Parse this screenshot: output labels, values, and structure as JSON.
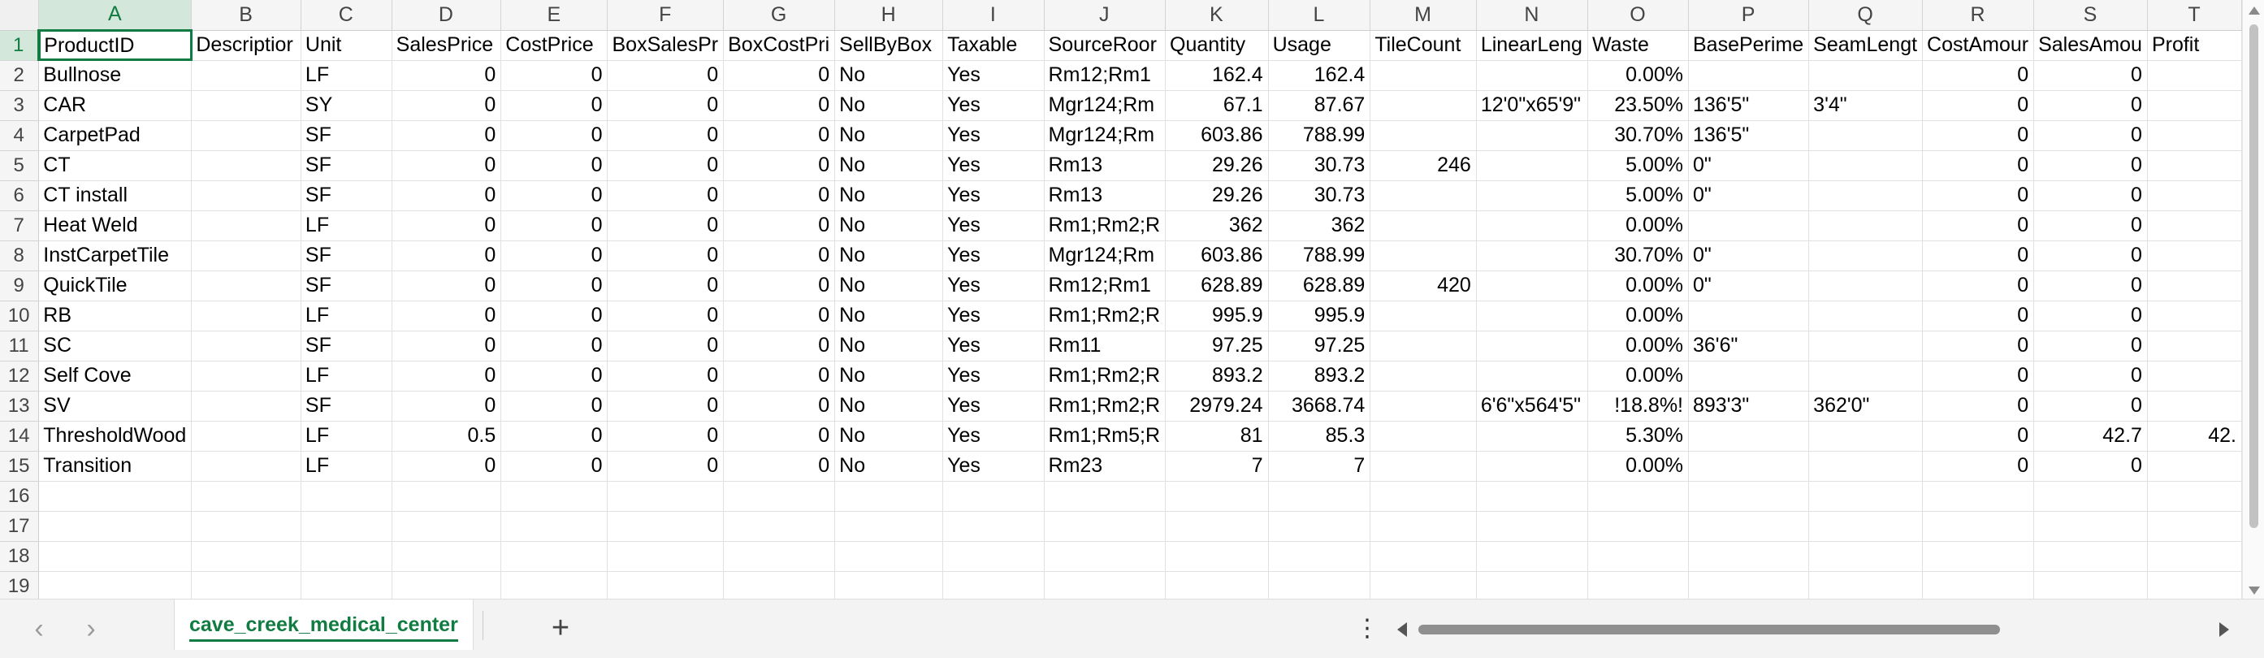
{
  "grid": {
    "column_letters": [
      "A",
      "B",
      "C",
      "D",
      "E",
      "F",
      "G",
      "H",
      "I",
      "J",
      "K",
      "L",
      "M",
      "N",
      "O",
      "P",
      "Q",
      "R",
      "S",
      "T"
    ],
    "rows": [
      {
        "num": "1",
        "cells": [
          "ProductID",
          "Descriptior",
          "Unit",
          "SalesPrice",
          "CostPrice",
          "BoxSalesPr",
          "BoxCostPri",
          "SellByBox",
          "Taxable",
          "SourceRoor",
          "Quantity",
          "Usage",
          "TileCount",
          "LinearLeng",
          "Waste",
          "BasePerime",
          "SeamLengt",
          "CostAmour",
          "SalesAmou",
          "Profit"
        ]
      },
      {
        "num": "2",
        "cells": [
          "Bullnose",
          "",
          "LF",
          "0",
          "0",
          "0",
          "0",
          "No",
          "Yes",
          "Rm12;Rm1",
          "162.4",
          "162.4",
          "",
          "",
          "0.00%",
          "",
          "",
          "0",
          "0",
          ""
        ]
      },
      {
        "num": "3",
        "cells": [
          "CAR",
          "",
          "SY",
          "0",
          "0",
          "0",
          "0",
          "No",
          "Yes",
          "Mgr124;Rm",
          "67.1",
          "87.67",
          "",
          "12'0\"x65'9\"",
          "23.50%",
          "136'5\"",
          "3'4\"",
          "0",
          "0",
          ""
        ]
      },
      {
        "num": "4",
        "cells": [
          "CarpetPad",
          "",
          "SF",
          "0",
          "0",
          "0",
          "0",
          "No",
          "Yes",
          "Mgr124;Rm",
          "603.86",
          "788.99",
          "",
          "",
          "30.70%",
          "136'5\"",
          "",
          "0",
          "0",
          ""
        ]
      },
      {
        "num": "5",
        "cells": [
          "CT",
          "",
          "SF",
          "0",
          "0",
          "0",
          "0",
          "No",
          "Yes",
          "Rm13",
          "29.26",
          "30.73",
          "246",
          "",
          "5.00%",
          "0\"",
          "",
          "0",
          "0",
          ""
        ]
      },
      {
        "num": "6",
        "cells": [
          "CT install",
          "",
          "SF",
          "0",
          "0",
          "0",
          "0",
          "No",
          "Yes",
          "Rm13",
          "29.26",
          "30.73",
          "",
          "",
          "5.00%",
          "0\"",
          "",
          "0",
          "0",
          ""
        ]
      },
      {
        "num": "7",
        "cells": [
          "Heat Weld",
          "",
          "LF",
          "0",
          "0",
          "0",
          "0",
          "No",
          "Yes",
          "Rm1;Rm2;R",
          "362",
          "362",
          "",
          "",
          "0.00%",
          "",
          "",
          "0",
          "0",
          ""
        ]
      },
      {
        "num": "8",
        "cells": [
          "InstCarpetTile",
          "",
          "SF",
          "0",
          "0",
          "0",
          "0",
          "No",
          "Yes",
          "Mgr124;Rm",
          "603.86",
          "788.99",
          "",
          "",
          "30.70%",
          "0\"",
          "",
          "0",
          "0",
          ""
        ]
      },
      {
        "num": "9",
        "cells": [
          "QuickTile",
          "",
          "SF",
          "0",
          "0",
          "0",
          "0",
          "No",
          "Yes",
          "Rm12;Rm1",
          "628.89",
          "628.89",
          "420",
          "",
          "0.00%",
          "0\"",
          "",
          "0",
          "0",
          ""
        ]
      },
      {
        "num": "10",
        "cells": [
          "RB",
          "",
          "LF",
          "0",
          "0",
          "0",
          "0",
          "No",
          "Yes",
          "Rm1;Rm2;R",
          "995.9",
          "995.9",
          "",
          "",
          "0.00%",
          "",
          "",
          "0",
          "0",
          ""
        ]
      },
      {
        "num": "11",
        "cells": [
          "SC",
          "",
          "SF",
          "0",
          "0",
          "0",
          "0",
          "No",
          "Yes",
          "Rm11",
          "97.25",
          "97.25",
          "",
          "",
          "0.00%",
          "36'6\"",
          "",
          "0",
          "0",
          ""
        ]
      },
      {
        "num": "12",
        "cells": [
          "Self Cove",
          "",
          "LF",
          "0",
          "0",
          "0",
          "0",
          "No",
          "Yes",
          "Rm1;Rm2;R",
          "893.2",
          "893.2",
          "",
          "",
          "0.00%",
          "",
          "",
          "0",
          "0",
          ""
        ]
      },
      {
        "num": "13",
        "cells": [
          "SV",
          "",
          "SF",
          "0",
          "0",
          "0",
          "0",
          "No",
          "Yes",
          "Rm1;Rm2;R",
          "2979.24",
          "3668.74",
          "",
          "6'6\"x564'5\"",
          "!18.8%!",
          "893'3\"",
          "362'0\"",
          "0",
          "0",
          ""
        ]
      },
      {
        "num": "14",
        "cells": [
          "ThresholdWood",
          "",
          "LF",
          "0.5",
          "0",
          "0",
          "0",
          "No",
          "Yes",
          "Rm1;Rm5;R",
          "81",
          "85.3",
          "",
          "",
          "5.30%",
          "",
          "",
          "0",
          "42.7",
          "42."
        ]
      },
      {
        "num": "15",
        "cells": [
          "Transition",
          "",
          "LF",
          "0",
          "0",
          "0",
          "0",
          "No",
          "Yes",
          "Rm23",
          "7",
          "7",
          "",
          "",
          "0.00%",
          "",
          "",
          "0",
          "0",
          ""
        ]
      },
      {
        "num": "16",
        "cells": [
          "",
          "",
          "",
          "",
          "",
          "",
          "",
          "",
          "",
          "",
          "",
          "",
          "",
          "",
          "",
          "",
          "",
          "",
          "",
          ""
        ]
      },
      {
        "num": "17",
        "cells": [
          "",
          "",
          "",
          "",
          "",
          "",
          "",
          "",
          "",
          "",
          "",
          "",
          "",
          "",
          "",
          "",
          "",
          "",
          "",
          ""
        ]
      },
      {
        "num": "18",
        "cells": [
          "",
          "",
          "",
          "",
          "",
          "",
          "",
          "",
          "",
          "",
          "",
          "",
          "",
          "",
          "",
          "",
          "",
          "",
          "",
          ""
        ]
      },
      {
        "num": "19",
        "cells": [
          "",
          "",
          "",
          "",
          "",
          "",
          "",
          "",
          "",
          "",
          "",
          "",
          "",
          "",
          "",
          "",
          "",
          "",
          "",
          ""
        ]
      }
    ]
  },
  "sheet_tabs": {
    "active_tab": "cave_creek_medical_center",
    "add_sheet_glyph": "+",
    "more_glyph": "⋮",
    "prev_glyph": "‹",
    "next_glyph": "›"
  },
  "icons": [
    "chevron-left-icon",
    "chevron-right-icon",
    "plus-icon",
    "more-vertical-icon",
    "scroll-up-icon",
    "scroll-down-icon",
    "scroll-left-icon",
    "scroll-right-icon"
  ],
  "colors": {
    "accent": "#107c41",
    "header_bg": "#f5f5f5",
    "active_header_bg": "#d4e7db",
    "gridline": "#e1e1e1"
  }
}
